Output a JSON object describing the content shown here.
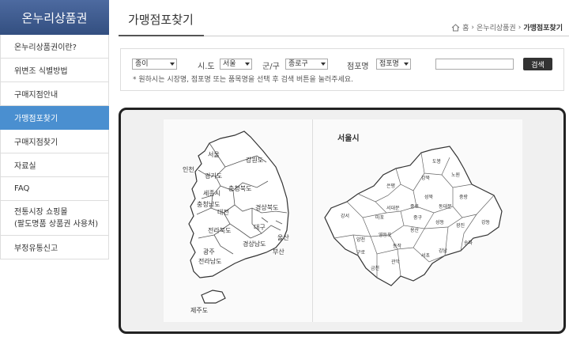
{
  "sidebar": {
    "title": "온누리상품권",
    "items": [
      {
        "label": "온누리상품권이란?",
        "active": false
      },
      {
        "label": "위변조 식별방법",
        "active": false
      },
      {
        "label": "구매지점안내",
        "active": false
      },
      {
        "label": "가맹점포찾기",
        "active": true
      },
      {
        "label": "구매지점찾기",
        "active": false
      },
      {
        "label": "자료실",
        "active": false
      },
      {
        "label": "FAQ",
        "active": false
      },
      {
        "label": "전통시장 쇼핑몰 (팔도명품 상품권 사용처)",
        "line1": "전통시장 쇼핑몰",
        "line2": "(팔도명품 상품권 사용처)",
        "active": false
      },
      {
        "label": "부정유통신고",
        "active": false
      }
    ]
  },
  "header": {
    "title": "가맹점포찾기",
    "breadcrumb": [
      "홈",
      "온누리상품권",
      "가맹점포찾기"
    ]
  },
  "search": {
    "type_value": "종이",
    "sido_label": "시.도",
    "sido_value": "서울",
    "gugun_label": "군/구",
    "gugun_value": "종로구",
    "store_label": "점포명",
    "store_value": "점포명",
    "keyword_value": "",
    "button_label": "검색",
    "hint": "* 원하시는 시장명, 점포명 또는 품목명을 선택 후 검색 버튼을 눌러주세요."
  },
  "korea_map": {
    "regions": [
      "서울",
      "인천",
      "경기도",
      "강원도",
      "충청북도",
      "세종시",
      "충청남도",
      "대전",
      "경상북도",
      "대구",
      "전라북도",
      "경상남도",
      "울산",
      "부산",
      "광주",
      "전라남도",
      "제주도"
    ]
  },
  "seoul_map": {
    "title": "서울시",
    "districts": [
      "도봉",
      "노원",
      "강북",
      "은평",
      "성북",
      "중랑",
      "종로",
      "동대문",
      "서대문",
      "마포",
      "중구",
      "성동",
      "광진",
      "강동",
      "용산",
      "강서",
      "양천",
      "영등포",
      "동작",
      "서초",
      "강남",
      "송파",
      "구로",
      "금천",
      "관악"
    ]
  }
}
